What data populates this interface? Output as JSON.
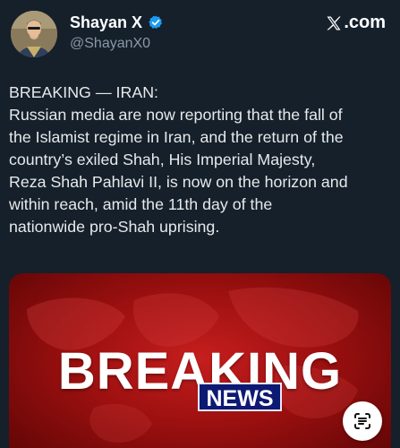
{
  "user": {
    "display_name": "Shayan X",
    "handle": "@ShayanX0",
    "avatar_icon": "avatar-portrait",
    "verified_icon": "verified-badge-icon",
    "verified_color": "#1d9bf0"
  },
  "brand": {
    "label": ".com",
    "icon": "x-logo-icon"
  },
  "post": {
    "lines": [
      "BREAKING — IRAN:",
      "Russian media are now reporting that the fall of",
      "the Islamist regime in Iran, and the return of the",
      "country’s exiled Shah, His Imperial Majesty,",
      "Reza Shah Pahlavi II, is now on the horizon and",
      "within reach, amid the 11th day of the",
      "nationwide pro-Shah uprising."
    ]
  },
  "media": {
    "headline": "BREAKING",
    "badge": "NEWS",
    "accent_red": "#c61e1e",
    "badge_blue": "#0d1a73",
    "scan_icon": "text-scan-icon"
  },
  "colors": {
    "background": "#15202b",
    "text": "#e7e9ea",
    "secondary_text": "#8b98a5"
  }
}
